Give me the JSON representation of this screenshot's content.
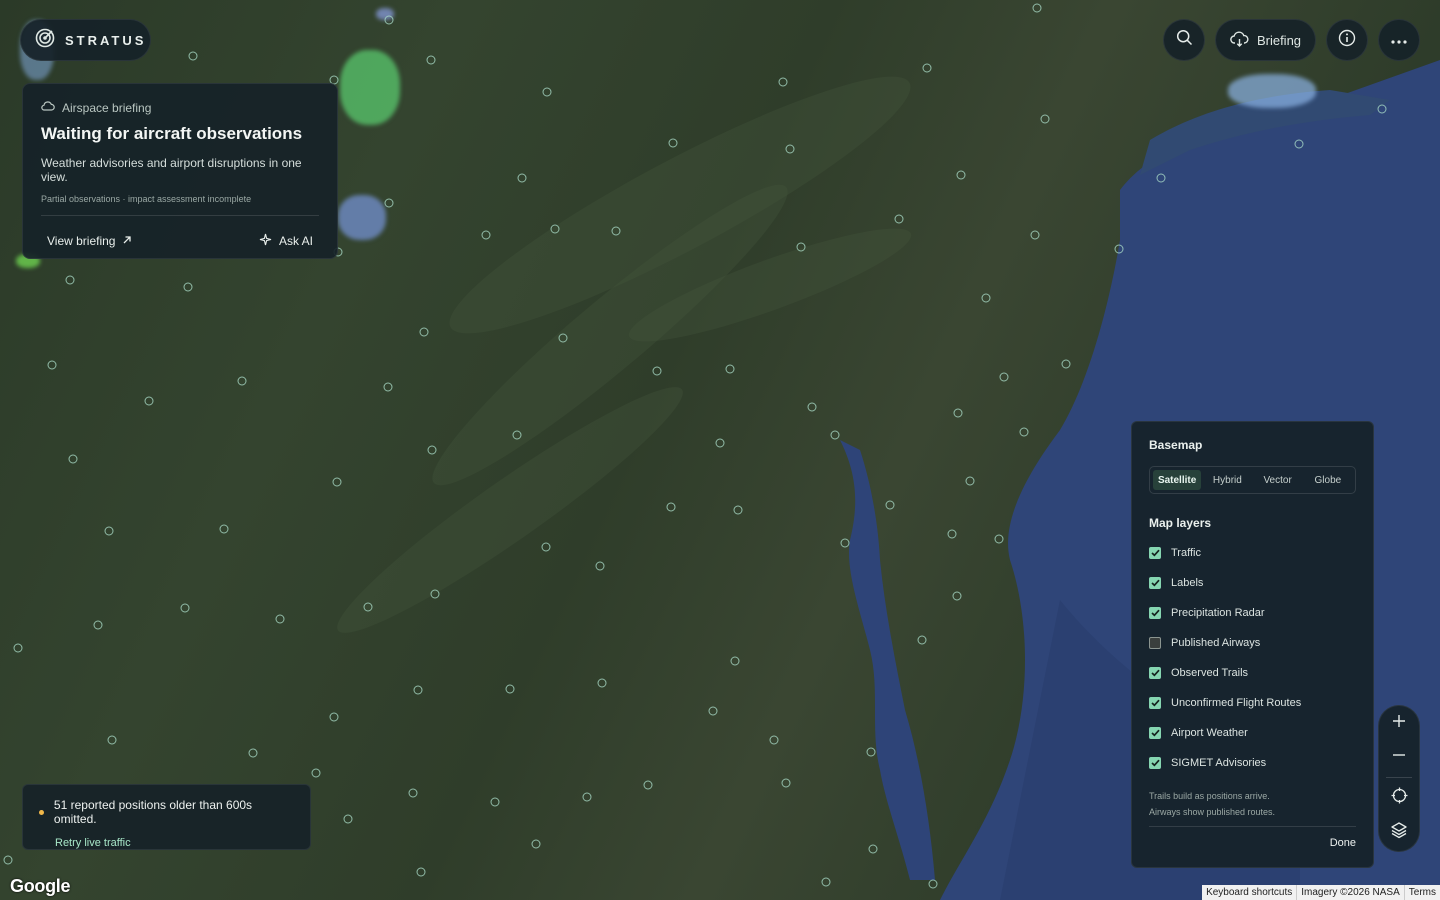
{
  "app": {
    "brand": "STRATUS"
  },
  "topbar": {
    "briefing_label": "Briefing"
  },
  "briefing_card": {
    "kicker": "Airspace briefing",
    "title": "Waiting for aircraft observations",
    "subtitle": "Weather advisories and airport disruptions in one view.",
    "note": "Partial observations · impact assessment incomplete",
    "view_label": "View briefing",
    "ask_label": "Ask AI"
  },
  "toast": {
    "message": "51 reported positions older than 600s omitted.",
    "action": "Retry live traffic"
  },
  "layers_panel": {
    "basemap_title": "Basemap",
    "basemaps": [
      "Satellite",
      "Hybrid",
      "Vector",
      "Globe"
    ],
    "selected_basemap": "Satellite",
    "layers_title": "Map layers",
    "layers": [
      {
        "label": "Traffic",
        "checked": true
      },
      {
        "label": "Labels",
        "checked": true
      },
      {
        "label": "Precipitation Radar",
        "checked": true
      },
      {
        "label": "Published Airways",
        "checked": false
      },
      {
        "label": "Observed Trails",
        "checked": true
      },
      {
        "label": "Unconfirmed Flight Routes",
        "checked": true
      },
      {
        "label": "Airport Weather",
        "checked": true
      },
      {
        "label": "SIGMET Advisories",
        "checked": true
      }
    ],
    "footnote_1": "Trails build as positions arrive.",
    "footnote_2": "Airways show published routes.",
    "done_label": "Done"
  },
  "attribution": {
    "google": "Google",
    "keyboard": "Keyboard shortcuts",
    "imagery": "Imagery ©2026 NASA",
    "terms": "Terms"
  },
  "colors": {
    "accent": "#86d6b1",
    "warning": "#f1b84a",
    "panel": "#16222a"
  }
}
